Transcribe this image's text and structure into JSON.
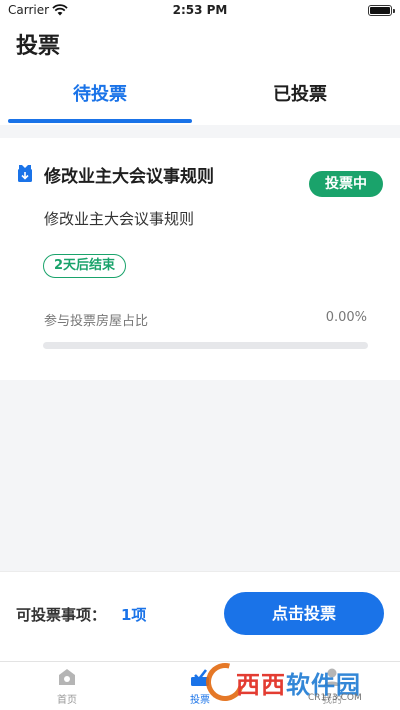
{
  "status_bar": {
    "carrier": "Carrier",
    "time": "2:53 PM"
  },
  "header": {
    "title": "投票"
  },
  "tabs": [
    {
      "label": "待投票",
      "active": true
    },
    {
      "label": "已投票",
      "active": false
    }
  ],
  "vote_card": {
    "title": "修改业主大会议事规则",
    "status": "投票中",
    "description": "修改业主大会议事规则",
    "deadline": "2天后结束",
    "participation_label": "参与投票房屋占比",
    "participation_value": "0.00%",
    "participation_fraction": 0
  },
  "footer": {
    "count_label": "可投票事项：",
    "count_value": "1项",
    "vote_button": "点击投票"
  },
  "tabbar": {
    "items": [
      {
        "label": "首页",
        "icon": "home-icon"
      },
      {
        "label": "投票",
        "icon": "ballot-icon",
        "active": true
      },
      {
        "label": "我的",
        "icon": "user-icon"
      }
    ]
  },
  "watermark": {
    "brand": "西西软件园",
    "domain": "CR173.COM"
  },
  "colors": {
    "primary": "#1a73e8",
    "success": "#1aa36b",
    "background": "#f4f5f7"
  }
}
